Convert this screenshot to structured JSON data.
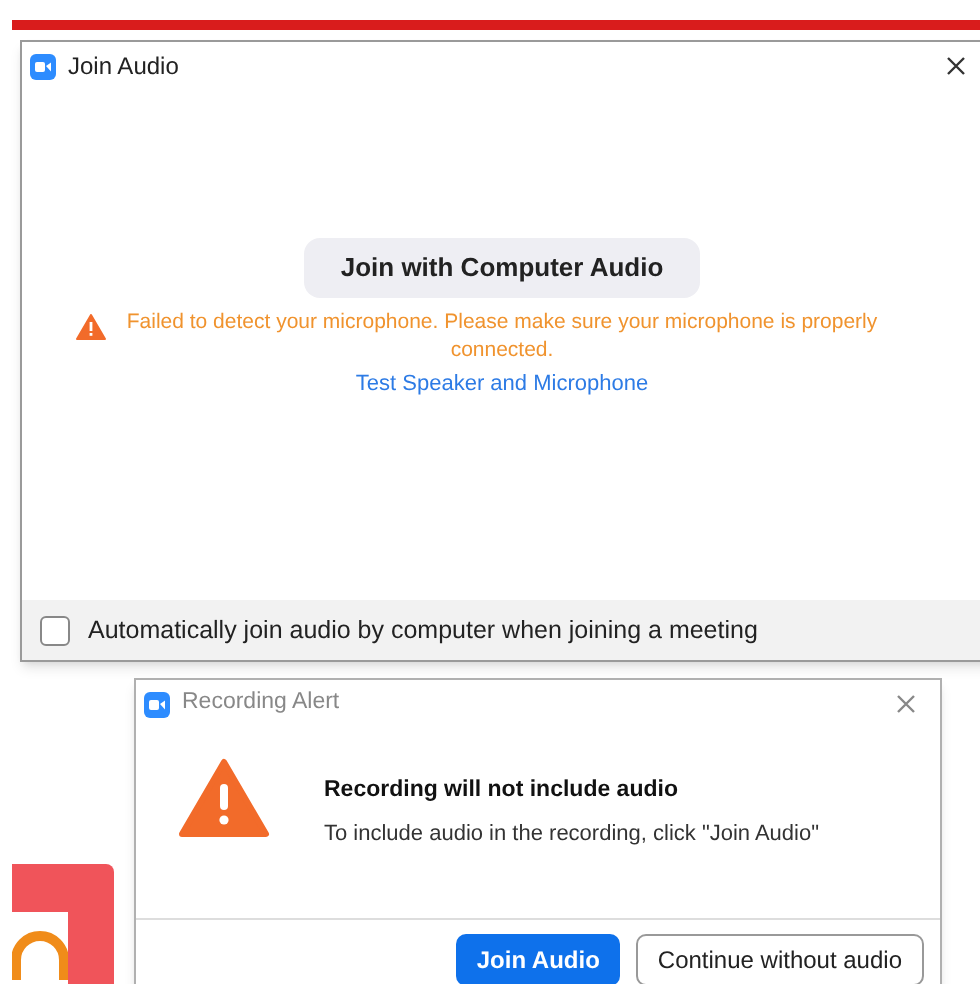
{
  "join_audio_window": {
    "title": "Join Audio",
    "join_button": "Join with Computer Audio",
    "warning": "Failed to detect your microphone. Please make sure your microphone is properly connected.",
    "test_link": "Test Speaker and Microphone",
    "auto_join": {
      "label": "Automatically join audio by computer when joining a meeting",
      "checked": false
    }
  },
  "recording_alert": {
    "title": "Recording Alert",
    "heading": "Recording will not include audio",
    "message": "To include audio in the recording, click \"Join Audio\"",
    "buttons": [
      {
        "label": "Join Audio",
        "kind": "primary"
      },
      {
        "label": "Continue without audio",
        "kind": "secondary"
      }
    ]
  }
}
